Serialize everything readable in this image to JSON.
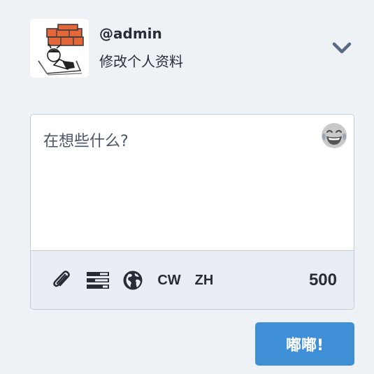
{
  "account": {
    "handle": "@admin",
    "edit_profile_label": "修改个人资料",
    "avatar_icon": "avatar-illustration",
    "menu_icon": "chevron-down-icon"
  },
  "compose": {
    "placeholder": "在想些什么?",
    "emoji_icon": "laughing-tears-emoji-icon",
    "tools": {
      "attach_icon": "paperclip-icon",
      "poll_icon": "poll-icon",
      "privacy_icon": "globe-icon",
      "cw_label": "CW",
      "language_label": "ZH"
    },
    "character_counter": "500",
    "publish_label": "嘟嘟!"
  },
  "colors": {
    "background": "#eef2f6",
    "accent": "#3e8fd6",
    "text": "#282c37",
    "chevron": "#5a6a85",
    "toolbar_bg": "#e9eef4"
  }
}
